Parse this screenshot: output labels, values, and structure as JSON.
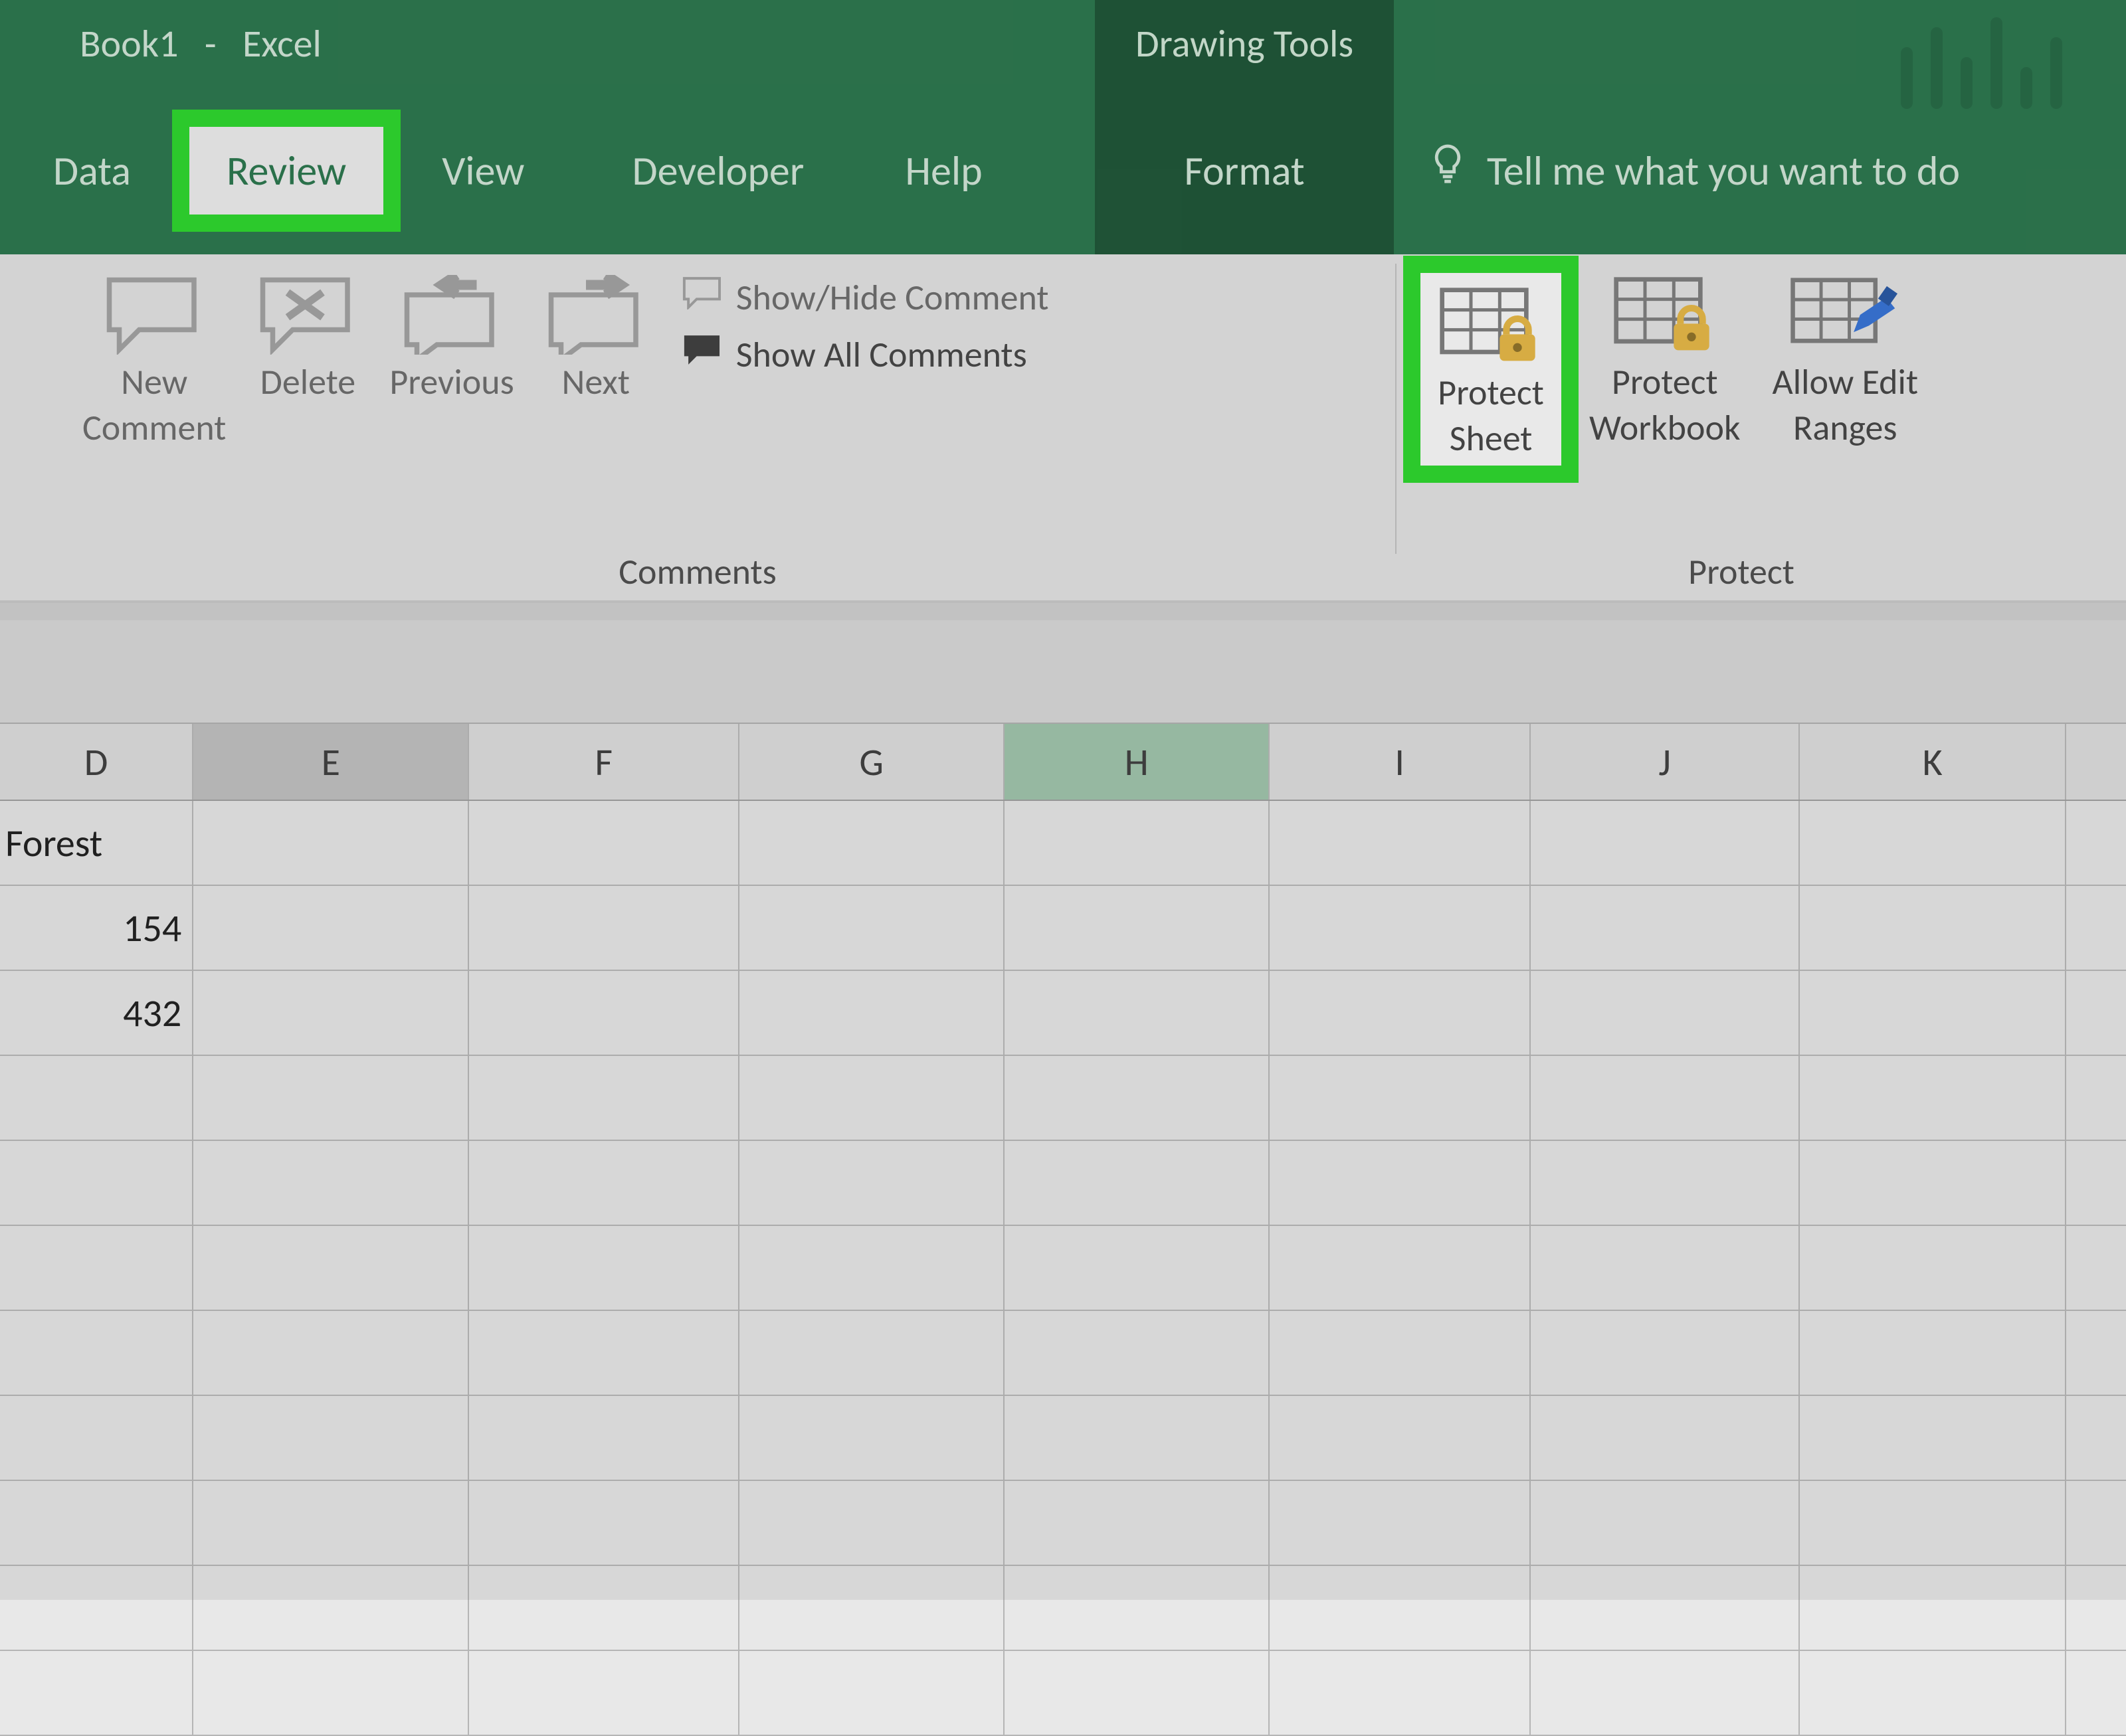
{
  "title": {
    "book": "Book1",
    "dash": "-",
    "app": "Excel"
  },
  "context_tab": "Drawing Tools",
  "tabs": {
    "data": "Data",
    "review": "Review",
    "view": "View",
    "developer": "Developer",
    "help": "Help",
    "format": "Format"
  },
  "tellme": "Tell me what you want to do",
  "ribbon": {
    "comments": {
      "new_comment_l1": "New",
      "new_comment_l2": "Comment",
      "delete": "Delete",
      "previous": "Previous",
      "next": "Next",
      "show_hide": "Show/Hide Comment",
      "show_all": "Show All Comments",
      "group_label": "Comments"
    },
    "protect": {
      "protect_sheet_l1": "Protect",
      "protect_sheet_l2": "Sheet",
      "protect_workbook_l1": "Protect",
      "protect_workbook_l2": "Workbook",
      "allow_edit_l1": "Allow Edit",
      "allow_edit_l2": "Ranges",
      "group_label": "Protect"
    }
  },
  "columns": [
    "D",
    "E",
    "F",
    "G",
    "H",
    "I",
    "J",
    "K"
  ],
  "selected_cols": {
    "primary": "E",
    "secondary": "H"
  },
  "cells": {
    "D1": "Forest",
    "D2": "154",
    "D3": "432"
  }
}
